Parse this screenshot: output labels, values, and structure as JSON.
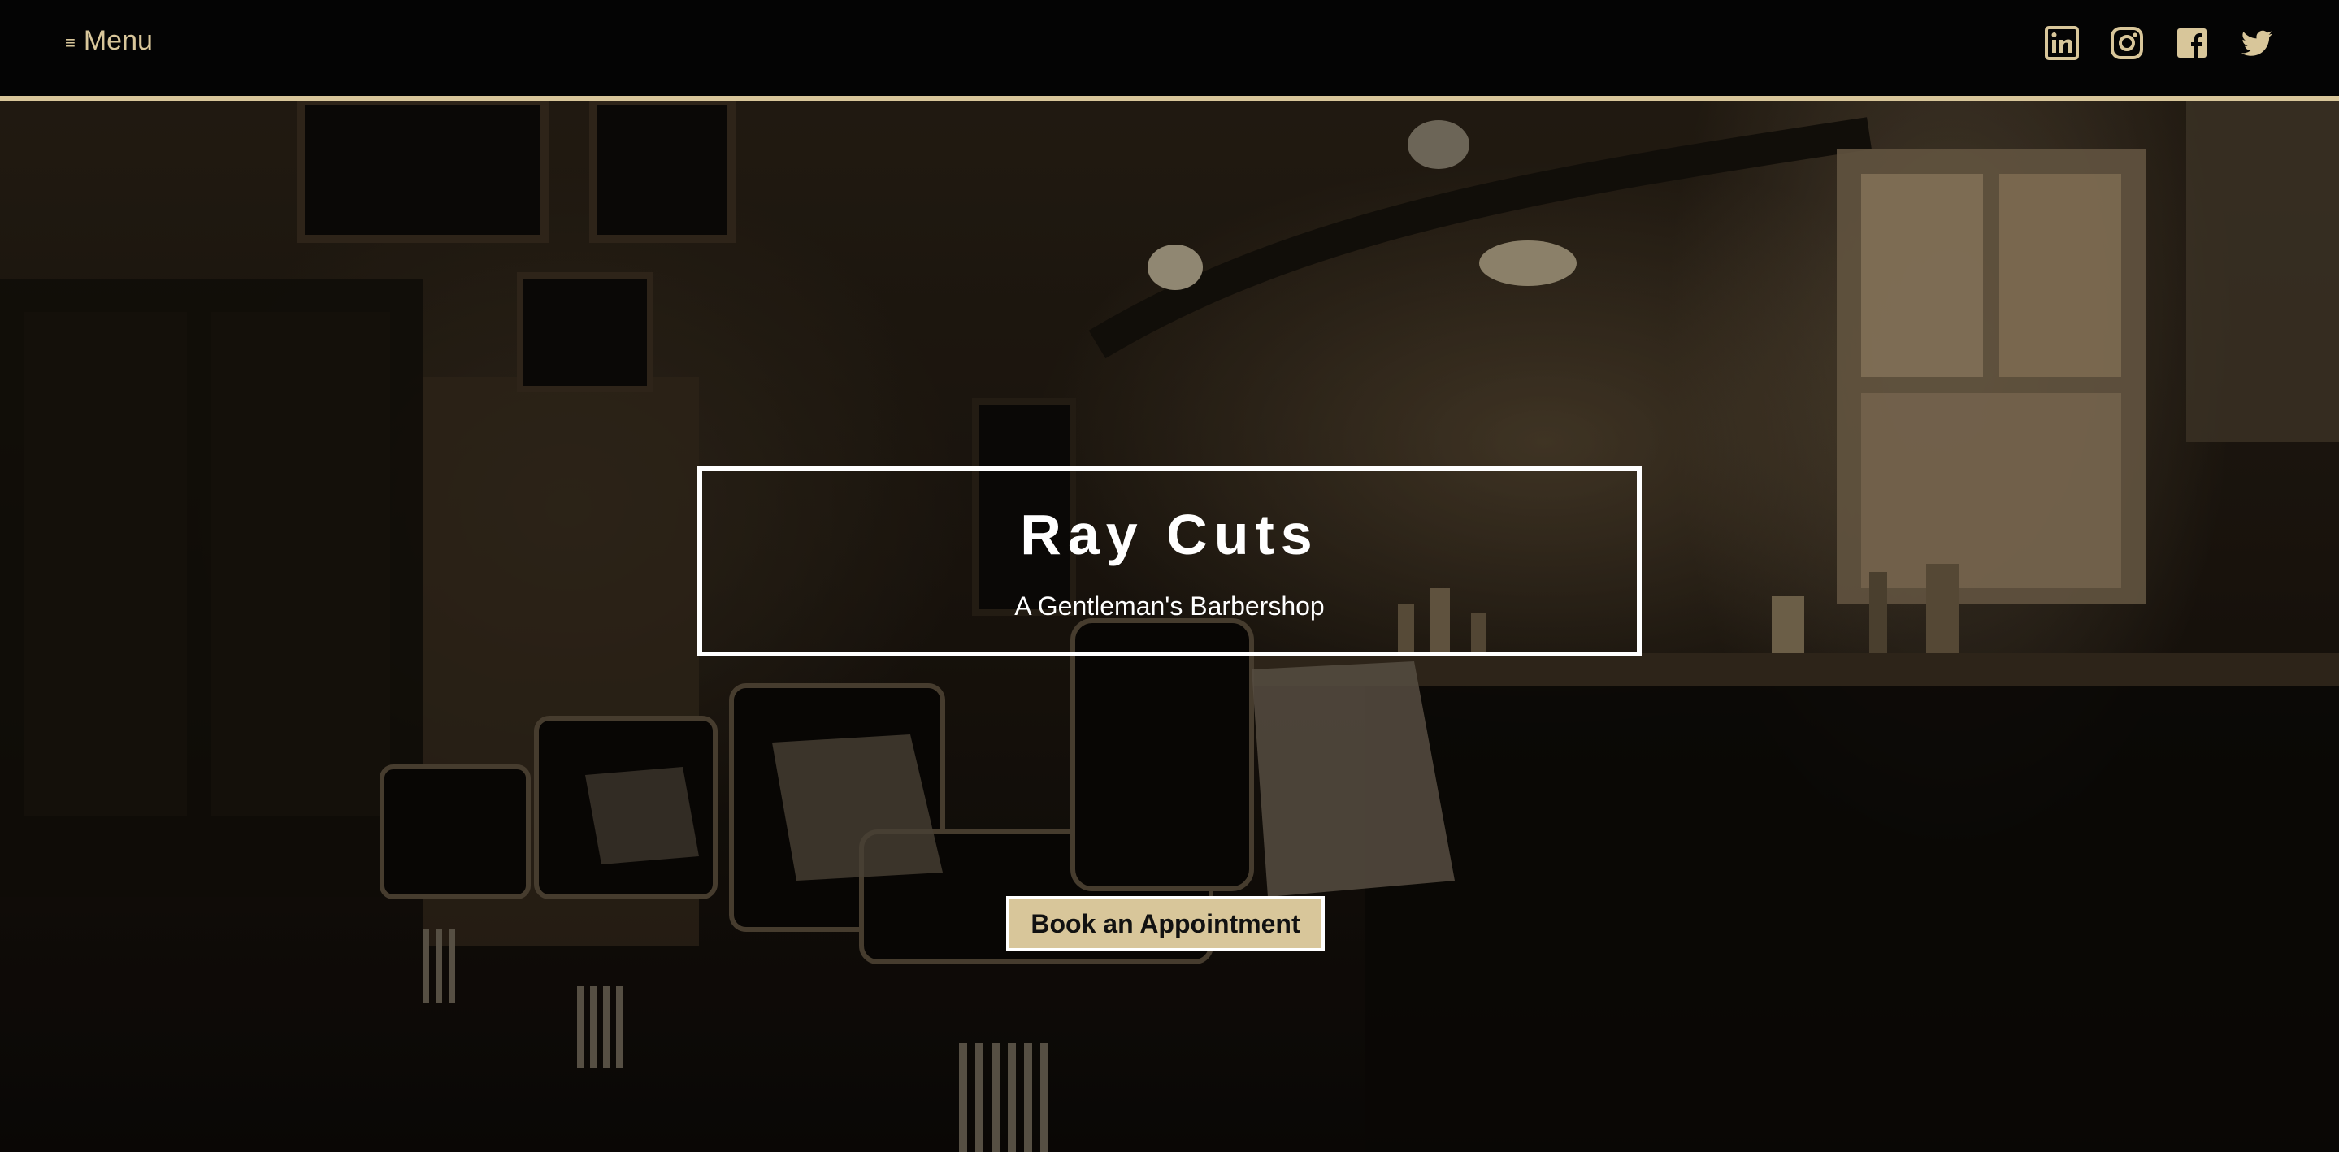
{
  "header": {
    "menu_icon": "hamburger-icon",
    "menu_glyph": "≡",
    "menu_label": "Menu",
    "socials": [
      {
        "name": "linkedin-icon"
      },
      {
        "name": "instagram-icon"
      },
      {
        "name": "facebook-icon"
      },
      {
        "name": "twitter-icon"
      }
    ]
  },
  "hero": {
    "title": "Ray Cuts",
    "subtitle": "A Gentleman's Barbershop",
    "cta_label": "Book an Appointment",
    "background": "barbershop-interior-photo"
  },
  "colors": {
    "accent": "#d8c69a",
    "header_bg": "#040404",
    "text_light": "#ffffff"
  }
}
